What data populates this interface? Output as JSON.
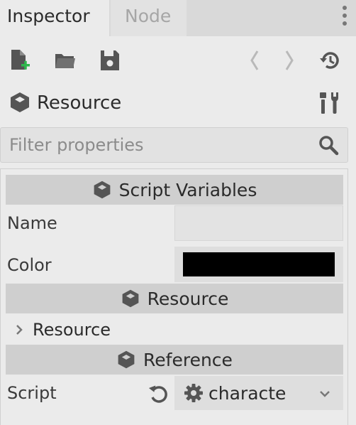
{
  "tabs": [
    {
      "label": "Inspector",
      "active": true
    },
    {
      "label": "Node",
      "active": false
    }
  ],
  "toolbar": {
    "icons": [
      "new-resource-icon",
      "open-folder-icon",
      "save-icon",
      "back-arrow-icon",
      "forward-arrow-icon",
      "history-icon"
    ],
    "accent_color": "#2fb84d"
  },
  "resource_header": {
    "title": "Resource",
    "icon": "cube-icon",
    "tools_icon": "tools-icon"
  },
  "filter": {
    "placeholder": "Filter properties"
  },
  "sections": {
    "script_variables": "Script Variables",
    "resource": "Resource",
    "reference": "Reference"
  },
  "properties": {
    "name_label": "Name",
    "name_value": "",
    "color_label": "Color",
    "color_value": "#000000",
    "resource_sub_label": "Resource",
    "script_label": "Script",
    "script_value": "characte"
  }
}
